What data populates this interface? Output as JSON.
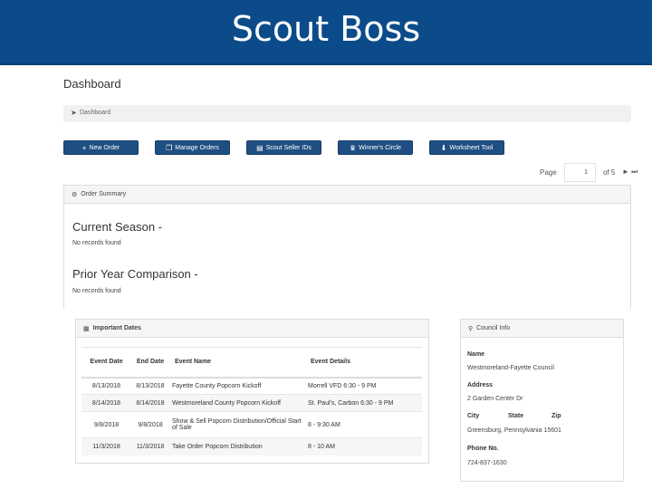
{
  "slide_title": "Scout Boss",
  "page_title": "Dashboard",
  "breadcrumb": {
    "icon": "send-icon",
    "label": "Dashboard"
  },
  "toolbar": [
    {
      "label": "New Order",
      "icon": "plus-icon"
    },
    {
      "label": "Manage Orders",
      "icon": "copy-icon"
    },
    {
      "label": "Scout Seller IDs",
      "icon": "id-card-icon"
    },
    {
      "label": "Winner's Circle",
      "icon": "trophy-icon"
    },
    {
      "label": "Worksheet Tool",
      "icon": "download-icon"
    }
  ],
  "pager": {
    "label": "Page",
    "current": "1",
    "of_label": "of 5",
    "nav": "► ⏭"
  },
  "order_summary": {
    "title": "Order Summary",
    "current_season": "Current Season -",
    "current_empty": "No records found",
    "prior_year": "Prior Year Comparison -",
    "prior_empty": "No records found"
  },
  "important_dates": {
    "title": "Important Dates",
    "headers": {
      "event_date": "Event Date",
      "end_date": "End Date",
      "event_name": "Event Name",
      "event_details": "Event Details"
    },
    "rows": [
      {
        "event_date": "8/13/2018",
        "end_date": "8/13/2018",
        "event_name": "Fayette County Popcorn Kickoff",
        "event_details": "Morrell VFD 6:30 - 9 PM"
      },
      {
        "event_date": "8/14/2018",
        "end_date": "8/14/2018",
        "event_name": "Westmoreland County Popcorn Kickoff",
        "event_details": "St. Paul's, Carbon 6:30 - 9 PM"
      },
      {
        "event_date": "9/8/2018",
        "end_date": "9/8/2018",
        "event_name": "Show & Sell Popcorn Distribution/Official Start of Sale",
        "event_details": "8 - 9:30 AM"
      },
      {
        "event_date": "11/3/2018",
        "end_date": "11/3/2018",
        "event_name": "Take Order Popcorn Distribution",
        "event_details": "8 - 10 AM"
      }
    ]
  },
  "council_info": {
    "title": "Council Info",
    "name_label": "Name",
    "name_value": "Westmoreland-Fayette Council",
    "address_label": "Address",
    "address_value": "2 Garden Center Dr",
    "city_label": "City",
    "state_label": "State",
    "zip_label": "Zip",
    "city_state_zip": "Greensburg, Pennsylvania 15601",
    "phone_label": "Phone No.",
    "phone_value": "724-837-1630"
  },
  "colors": {
    "title_bar": "#0b4b8a",
    "button": "#1f4f82"
  }
}
